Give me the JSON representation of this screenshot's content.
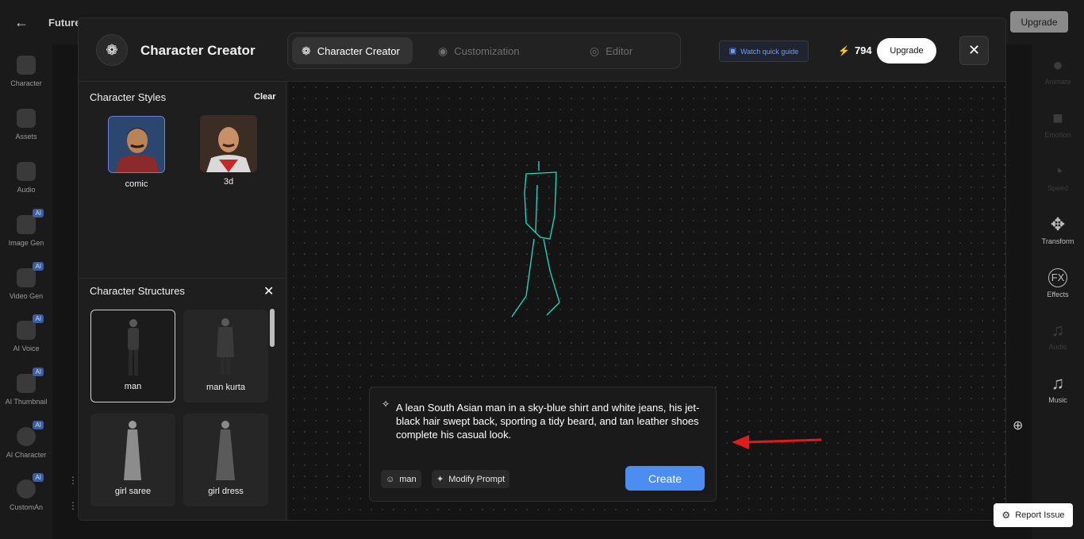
{
  "topbar": {
    "back_icon": "arrow-left-icon",
    "project_title": "Future",
    "upgrade_label": "Upgrade"
  },
  "left_nav": {
    "items": [
      {
        "label": "Character",
        "icon": "character-icon",
        "ai": false
      },
      {
        "label": "Assets",
        "icon": "assets-icon",
        "ai": false
      },
      {
        "label": "Audio",
        "icon": "audio-icon",
        "ai": false
      },
      {
        "label": "Image Gen",
        "icon": "image-gen-icon",
        "ai": true
      },
      {
        "label": "Video Gen",
        "icon": "video-gen-icon",
        "ai": true
      },
      {
        "label": "AI Voice",
        "icon": "ai-voice-icon",
        "ai": true
      },
      {
        "label": "AI Thumbnail",
        "icon": "ai-thumbnail-icon",
        "ai": true
      },
      {
        "label": "AI Character",
        "icon": "ai-character-icon",
        "ai": true
      },
      {
        "label": "CustomAn",
        "icon": "custom-animation-icon",
        "ai": true
      }
    ],
    "ai_badge": "AI"
  },
  "right_nav": {
    "items": [
      {
        "label": "Animate",
        "icon": "animate-icon",
        "enabled": false
      },
      {
        "label": "Emotion",
        "icon": "emotion-icon",
        "enabled": false
      },
      {
        "label": "Speed",
        "icon": "speed-icon",
        "enabled": false
      },
      {
        "label": "Transform",
        "icon": "transform-icon",
        "enabled": true
      },
      {
        "label": "Effects",
        "icon": "effects-icon",
        "enabled": true
      },
      {
        "label": "Audio",
        "icon": "audio-icon",
        "enabled": false
      },
      {
        "label": "Music",
        "icon": "music-icon",
        "enabled": true
      }
    ]
  },
  "modal": {
    "title": "Character Creator",
    "tabs": [
      {
        "label": "Character Creator",
        "active": true
      },
      {
        "label": "Customization",
        "active": false
      },
      {
        "label": "Editor",
        "active": false
      }
    ],
    "watch_guide_label": "Watch quick guide",
    "credits": "794",
    "upgrade_label": "Upgrade"
  },
  "styles_panel": {
    "title": "Character Styles",
    "clear_label": "Clear",
    "styles": [
      {
        "label": "comic",
        "selected": true
      },
      {
        "label": "3d",
        "selected": false
      }
    ]
  },
  "structures_panel": {
    "title": "Character Structures",
    "items": [
      {
        "label": "man",
        "selected": true
      },
      {
        "label": "man kurta",
        "selected": false
      },
      {
        "label": "girl saree",
        "selected": false
      },
      {
        "label": "girl dress",
        "selected": false
      }
    ]
  },
  "prompt": {
    "text": "A lean South Asian man in a sky-blue shirt and white jeans, his jet-black hair swept back, sporting a tidy beard, and tan leather shoes complete his casual look.",
    "chip_structure": "man",
    "chip_modify": "Modify Prompt",
    "create_label": "Create"
  },
  "report_issue_label": "Report Issue",
  "colors": {
    "accent": "#4b8df0",
    "arrow": "#e01b1b",
    "skeleton": "#19e0c8"
  }
}
